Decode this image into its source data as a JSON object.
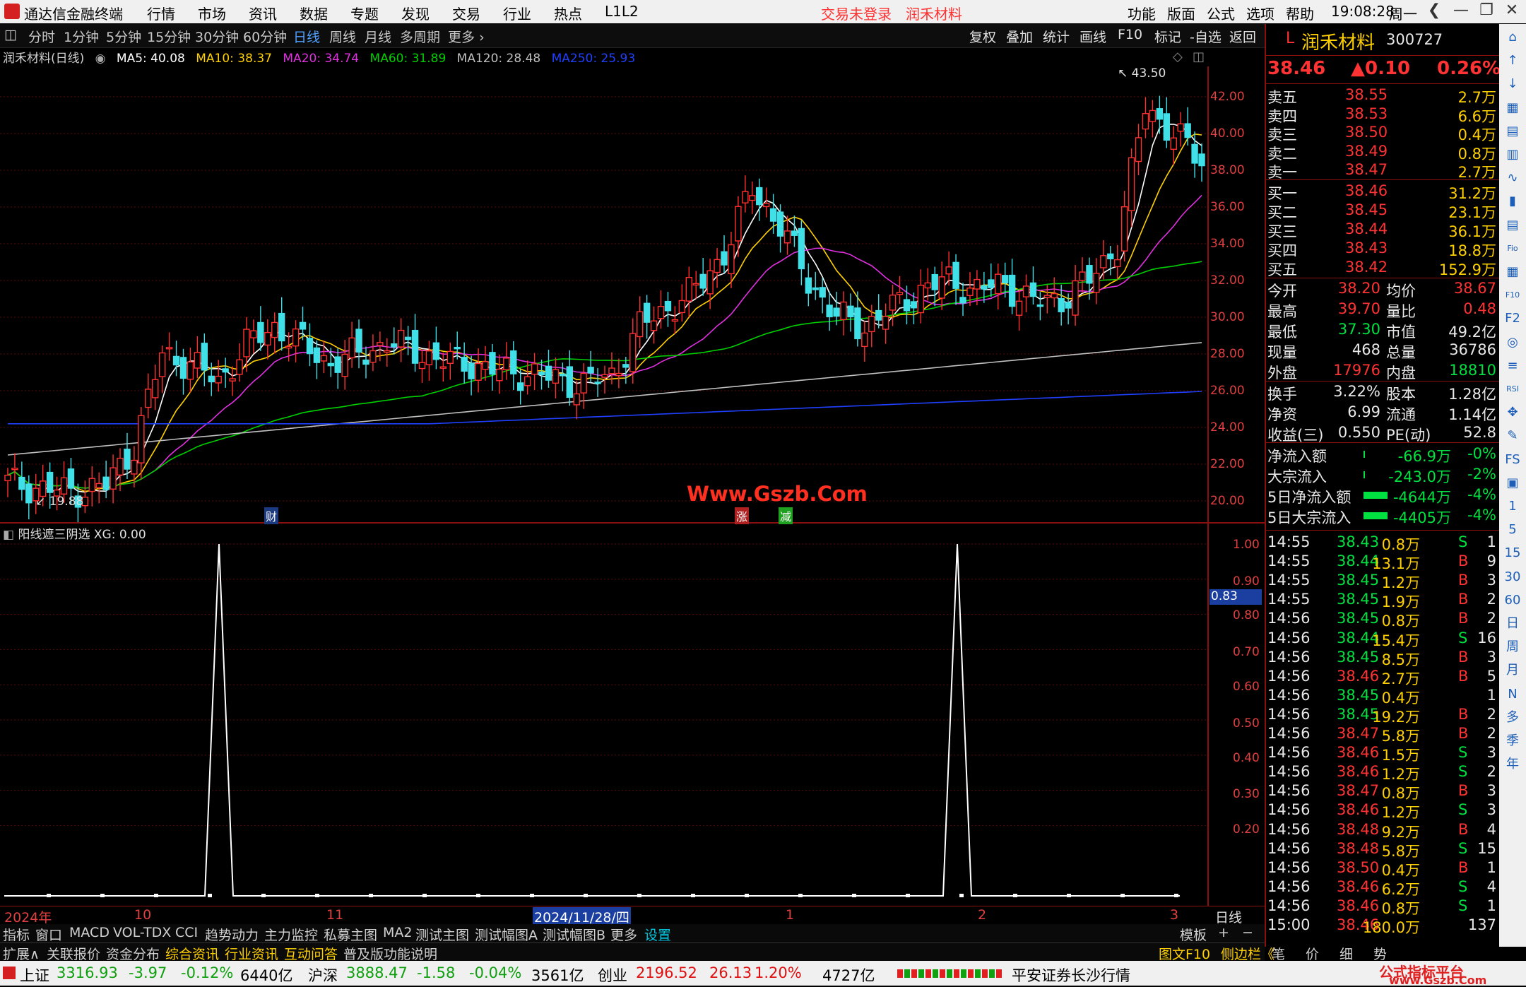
{
  "titlebar": {
    "app_name": "通达信金融终端",
    "menus": [
      "行情",
      "市场",
      "资讯",
      "数据",
      "专题",
      "发现",
      "交易",
      "行业",
      "热点",
      "L1L2"
    ],
    "login_status": "交易未登录",
    "stock_title": "润禾材料",
    "right_menus": [
      "功能",
      "版面",
      "公式",
      "选项",
      "帮助"
    ],
    "clock": "19:08:28",
    "weekday": "周一"
  },
  "periodbar": {
    "items": [
      "分时",
      "1分钟",
      "5分钟",
      "15分钟",
      "30分钟",
      "60分钟",
      "日线",
      "周线",
      "月线",
      "多周期",
      "更多"
    ],
    "active": "日线",
    "right_items": [
      "复权",
      "叠加",
      "统计",
      "画线",
      "F10",
      "标记",
      "-自选",
      "返回"
    ]
  },
  "ma_legend": {
    "name": "润禾材料(日线)",
    "ma5": "MA5: 40.08",
    "ma10": "MA10: 38.37",
    "ma20": "MA20: 34.74",
    "ma60": "MA60: 31.89",
    "ma120": "MA120: 28.48",
    "ma250": "MA250: 25.93",
    "colors": {
      "ma5": "#ffffff",
      "ma10": "#ffd000",
      "ma20": "#e030e0",
      "ma60": "#00d000",
      "ma120": "#c0c0c0",
      "ma250": "#2040ff"
    }
  },
  "main_chart": {
    "y_ticks": [
      "42.00",
      "40.00",
      "38.00",
      "36.00",
      "34.00",
      "32.00",
      "30.00",
      "28.00",
      "26.00",
      "24.00",
      "22.00",
      "20.00"
    ],
    "high_label": "43.50",
    "low_label": "19.88",
    "watermark": "Www.Gszb.Com",
    "markers": [
      "财",
      "涨",
      "减"
    ]
  },
  "indicator": {
    "title": "阳线遮三阴选",
    "value": "XG: 0.00",
    "y_ticks": [
      "1.00",
      "0.90",
      "0.80",
      "0.70",
      "0.60",
      "0.50",
      "0.40",
      "0.30",
      "0.20"
    ],
    "cursor_value": "0.83"
  },
  "xaxis": {
    "labels": [
      "2024年",
      "10",
      "11",
      "2024/11/28/四",
      "1",
      "2",
      "3"
    ],
    "period": "日线"
  },
  "tabbar1": {
    "items": [
      "指标",
      "窗口",
      "MACD",
      "VOL-TDX",
      "CCI",
      "趋势动力",
      "主力监控",
      "私募主图",
      "MA2",
      "测试主图",
      "测试幅图A",
      "测试幅图B",
      "更多",
      "设置"
    ],
    "right": [
      "模板",
      "+",
      "−"
    ]
  },
  "tabbar2": {
    "items": [
      "扩展∧",
      "关联报价",
      "资金分布",
      "综合资讯",
      "行业资讯",
      "互动问答",
      "普及版功能说明"
    ],
    "right": [
      "图文F10",
      "侧边栏《",
      "笔",
      "价",
      "细",
      "势"
    ]
  },
  "quote": {
    "code_prefix": "L",
    "name": "润禾材料",
    "code": "300727",
    "price": "38.46",
    "change": "▲0.10",
    "pct": "0.26%",
    "asks": [
      {
        "label": "卖五",
        "price": "38.55",
        "vol": "2.7万"
      },
      {
        "label": "卖四",
        "price": "38.53",
        "vol": "6.6万"
      },
      {
        "label": "卖三",
        "price": "38.50",
        "vol": "0.4万"
      },
      {
        "label": "卖二",
        "price": "38.49",
        "vol": "0.8万"
      },
      {
        "label": "卖一",
        "price": "38.47",
        "vol": "2.7万"
      }
    ],
    "bids": [
      {
        "label": "买一",
        "price": "38.46",
        "vol": "31.2万"
      },
      {
        "label": "买二",
        "price": "38.45",
        "vol": "23.1万"
      },
      {
        "label": "买三",
        "price": "38.44",
        "vol": "36.1万"
      },
      {
        "label": "买四",
        "price": "38.43",
        "vol": "18.8万"
      },
      {
        "label": "买五",
        "price": "38.42",
        "vol": "152.9万"
      }
    ],
    "stats": [
      {
        "l1": "今开",
        "v1": "38.20",
        "l2": "均价",
        "v2": "38.67"
      },
      {
        "l1": "最高",
        "v1": "39.70",
        "l2": "量比",
        "v2": "0.48"
      },
      {
        "l1": "最低",
        "v1": "37.30",
        "l2": "市值",
        "v2": "49.2亿"
      },
      {
        "l1": "现量",
        "v1": "468",
        "l2": "总量",
        "v2": "36786"
      },
      {
        "l1": "外盘",
        "v1": "17976",
        "l2": "内盘",
        "v2": "18810"
      }
    ],
    "stats2": [
      {
        "l1": "换手",
        "v1": "3.22%",
        "l2": "股本",
        "v2": "1.28亿"
      },
      {
        "l1": "净资",
        "v1": "6.99",
        "l2": "流通",
        "v2": "1.14亿"
      },
      {
        "l1": "收益(三)",
        "v1": "0.550",
        "l2": "PE(动)",
        "v2": "52.8"
      }
    ],
    "flows": [
      {
        "label": "净流入额",
        "value": "-66.9万",
        "pct": "-0%"
      },
      {
        "label": "大宗流入",
        "value": "-243.0万",
        "pct": "-2%"
      },
      {
        "label": "5日净流入额",
        "value": "-4644万",
        "pct": "-4%"
      },
      {
        "label": "5日大宗流入",
        "value": "-4405万",
        "pct": "-4%"
      }
    ],
    "ticks": [
      {
        "t": "14:55",
        "p": "38.43",
        "v": "0.8万",
        "d": "S",
        "n": "1"
      },
      {
        "t": "14:55",
        "p": "38.44",
        "v": "13.1万",
        "d": "B",
        "n": "9"
      },
      {
        "t": "14:55",
        "p": "38.45",
        "v": "1.2万",
        "d": "B",
        "n": "3"
      },
      {
        "t": "14:55",
        "p": "38.45",
        "v": "1.9万",
        "d": "B",
        "n": "2"
      },
      {
        "t": "14:56",
        "p": "38.45",
        "v": "0.8万",
        "d": "B",
        "n": "2"
      },
      {
        "t": "14:56",
        "p": "38.44",
        "v": "15.4万",
        "d": "S",
        "n": "16"
      },
      {
        "t": "14:56",
        "p": "38.45",
        "v": "8.5万",
        "d": "B",
        "n": "3"
      },
      {
        "t": "14:56",
        "p": "38.46",
        "v": "2.7万",
        "d": "B",
        "n": "5"
      },
      {
        "t": "14:56",
        "p": "38.45",
        "v": "0.4万",
        "d": "",
        "n": "1"
      },
      {
        "t": "14:56",
        "p": "38.45",
        "v": "19.2万",
        "d": "B",
        "n": "2"
      },
      {
        "t": "14:56",
        "p": "38.47",
        "v": "5.8万",
        "d": "B",
        "n": "2"
      },
      {
        "t": "14:56",
        "p": "38.46",
        "v": "1.5万",
        "d": "S",
        "n": "3"
      },
      {
        "t": "14:56",
        "p": "38.46",
        "v": "1.2万",
        "d": "S",
        "n": "2"
      },
      {
        "t": "14:56",
        "p": "38.47",
        "v": "0.8万",
        "d": "B",
        "n": "3"
      },
      {
        "t": "14:56",
        "p": "38.46",
        "v": "1.2万",
        "d": "S",
        "n": "3"
      },
      {
        "t": "14:56",
        "p": "38.48",
        "v": "9.2万",
        "d": "B",
        "n": "4"
      },
      {
        "t": "14:56",
        "p": "38.48",
        "v": "5.8万",
        "d": "S",
        "n": "15"
      },
      {
        "t": "14:56",
        "p": "38.50",
        "v": "0.4万",
        "d": "B",
        "n": "1"
      },
      {
        "t": "14:56",
        "p": "38.46",
        "v": "6.2万",
        "d": "S",
        "n": "4"
      },
      {
        "t": "14:56",
        "p": "38.46",
        "v": "0.8万",
        "d": "S",
        "n": "1"
      },
      {
        "t": "15:00",
        "p": "38.46",
        "v": "180.0万",
        "d": "",
        "n": "137"
      }
    ]
  },
  "iconstrip": {
    "labels": [
      "⌂",
      "↑",
      "↓",
      "▦",
      "▤",
      "▥",
      "∿",
      "▮",
      "▤",
      "Fio",
      "▦",
      "F10",
      "F2",
      "◎",
      "≡",
      "RSI",
      "✥",
      "✎",
      "FS",
      "▣",
      "1",
      "5",
      "15",
      "30",
      "60",
      "日",
      "周",
      "月",
      "N",
      "多",
      "季",
      "年"
    ]
  },
  "statusbar": {
    "sh_name": "上证",
    "sh_val": "3316.93",
    "sh_chg": "-3.97",
    "sh_pct": "-0.12%",
    "sh_amt": "6440亿",
    "sz_name": "沪深",
    "sz_val": "3888.47",
    "sz_chg": "-1.58",
    "sz_pct": "-0.04%",
    "sz_amt": "3561亿",
    "cy_name": "创业",
    "cy_val": "2196.52",
    "cy_chg": "26.13",
    "cy_pct": "1.20%",
    "cy_amt": "4727亿",
    "broker": "平安证券长沙行情",
    "watermark_title": "公式指标平台",
    "watermark_url": "www.Gszb.Com"
  }
}
